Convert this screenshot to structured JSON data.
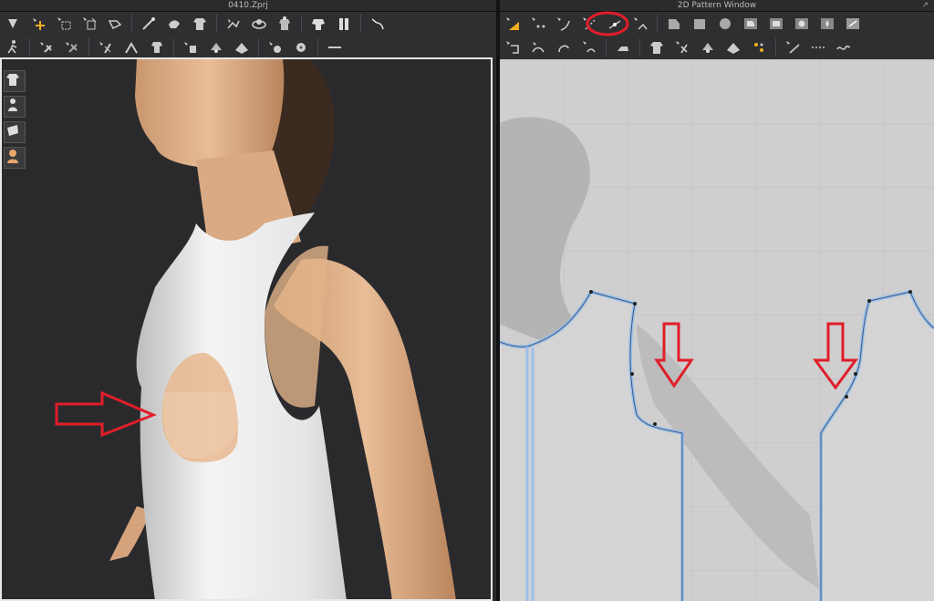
{
  "window_3d": {
    "title": "0410.Zprj"
  },
  "window_2d": {
    "title": "2D Pattern Window"
  },
  "toolbar_3d": {
    "row1": [
      "select-icon",
      "move-icon",
      "box-select-icon",
      "transform-icon",
      "fold-icon",
      "pin-icon",
      "tack-icon",
      "garment-icon",
      "arrangement-icon",
      "wrap-icon",
      "avatar-garment-icon",
      "fit-icon",
      "cut-icon",
      "undo-curve-icon"
    ],
    "row2": [
      "walk-icon",
      "strengthen-icon",
      "weaken-icon",
      "fold-line-icon",
      "bend-icon",
      "shrink-icon",
      "puckering-icon",
      "sewing-check-icon",
      "fabric-check-icon",
      "button-icon",
      "buttonhole-icon",
      "line-icon"
    ]
  },
  "toolbar_2d": {
    "row1": [
      "transform-pattern-icon",
      "edit-point-icon",
      "edit-curvature-icon",
      "curve-point-icon",
      "add-point-icon",
      "cut-icon",
      "polygon-icon",
      "rectangle-icon",
      "circle-icon",
      "internal-polygon-icon",
      "internal-rectangle-icon",
      "internal-circle-icon",
      "dart-icon",
      "trace-icon"
    ],
    "row2": [
      "segment-sewing-icon",
      "free-sewing-icon",
      "m-n-sewing-icon",
      "check-sewing-icon",
      "iron-icon",
      "edit-garment-icon",
      "fabric-grain-icon",
      "pin-icon",
      "tack-icon",
      "gizmo-icon",
      "internal-line-icon",
      "topstitch-icon",
      "pleat-icon"
    ]
  },
  "side_toolbar": [
    "show-garment-icon",
    "show-avatar-icon",
    "fabric-texture-icon",
    "avatar-skin-icon"
  ],
  "colors": {
    "seam_highlight": "#9cc0e8",
    "annotation_red": "#e01e2a",
    "garment_white": "#ececec",
    "skin": "#e0b38f",
    "pattern_bg": "#cfcfcf",
    "avatar_shadow": "#b4b4b4"
  }
}
